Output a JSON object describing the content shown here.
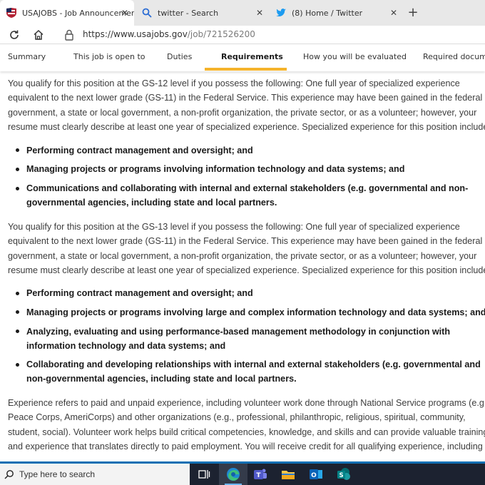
{
  "browser": {
    "tabs": [
      {
        "title": "USAJOBS - Job Announcement",
        "icon": "usajobs-favicon",
        "active": true
      },
      {
        "title": "twitter - Search",
        "icon": "search-icon",
        "active": false
      },
      {
        "title": "(8) Home / Twitter",
        "icon": "twitter-bird-icon",
        "active": false
      }
    ],
    "url_prefix": "https://www.usajobs.gov",
    "url_path": "/job/721526200"
  },
  "page": {
    "sections": [
      "Summary",
      "This job is open to",
      "Duties",
      "Requirements",
      "How you will be evaluated",
      "Required documen"
    ],
    "active_section": "Requirements",
    "gs12": {
      "lines": [
        "You qualify for this position at the GS-12 level if you possess the following: One full year of specialized experience",
        "equivalent to the next lower grade (GS-11) in the Federal Service.  This experience may have been gained in the federal",
        "government, a state or local government, a non-profit organization, the private sector, or as a volunteer; however, your",
        "resume must clearly describe at least one year of specialized experience. Specialized experience for this position includes"
      ],
      "bullets": [
        [
          "Performing contract management and oversight; and"
        ],
        [
          "Managing projects or programs involving information technology and data systems; and"
        ],
        [
          "Communications and collaborating with internal and external stakeholders (e.g. governmental and non-",
          "governmental agencies, including state and local partners."
        ]
      ]
    },
    "gs13": {
      "lines": [
        "You qualify for this position at the GS-13 level if you possess the following: One full year of specialized experience",
        "equivalent to the next lower grade (GS-11) in the Federal Service.  This experience may have been gained in the federal",
        "government, a state or local government, a non-profit organization, the private sector, or as a volunteer; however, your",
        "resume must clearly describe at least one year of specialized experience. Specialized experience for this position includes"
      ],
      "bullets": [
        [
          "Performing contract management and oversight; and"
        ],
        [
          "Managing projects or programs involving large and complex information technology and data systems; and"
        ],
        [
          "Analyzing, evaluating and using performance-based management methodology in conjunction with",
          "information technology and data systems; and"
        ],
        [
          "Collaborating and developing relationships with internal and external stakeholders (e.g. governmental and",
          "non-governmental agencies, including state and local partners."
        ]
      ]
    },
    "experience": {
      "lines": [
        "Experience refers to paid and unpaid experience, including volunteer work done through National Service programs (e.g.,",
        "Peace Corps, AmeriCorps) and other organizations (e.g., professional, philanthropic, religious, spiritual, community,",
        "student, social). Volunteer work helps build critical competencies, knowledge, and skills and can provide valuable training",
        "and experience that translates directly to paid employment. You will receive credit for all qualifying experience, including"
      ]
    }
  },
  "taskbar": {
    "search_placeholder": "Type here to search",
    "apps": [
      "task-view-icon",
      "edge-icon",
      "teams-icon",
      "file-explorer-icon",
      "outlook-icon",
      "sharepoint-icon"
    ]
  },
  "colors": {
    "accent_underline": "#f5b32b",
    "taskbar_bg": "#1c2230",
    "taskbar_border": "#0d6fb3"
  }
}
